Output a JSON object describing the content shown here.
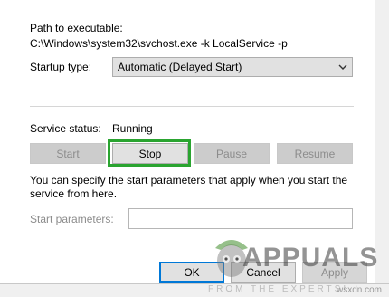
{
  "path": {
    "label": "Path to executable:",
    "value": "C:\\Windows\\system32\\svchost.exe -k LocalService -p"
  },
  "startup": {
    "label": "Startup type:",
    "selected": "Automatic (Delayed Start)"
  },
  "status": {
    "label": "Service status:",
    "value": "Running"
  },
  "buttons": {
    "start": "Start",
    "stop": "Stop",
    "pause": "Pause",
    "resume": "Resume"
  },
  "description": "You can specify the start parameters that apply when you start the service from here.",
  "start_params": {
    "label": "Start parameters:",
    "value": ""
  },
  "footer": {
    "ok": "OK",
    "cancel": "Cancel",
    "apply": "Apply"
  },
  "watermark": {
    "brand": "APPUALS",
    "tagline": "FROM THE EXPERTS!",
    "site": "wsxdn.com"
  },
  "colors": {
    "highlight": "#2aa430",
    "focus": "#0078d7"
  }
}
